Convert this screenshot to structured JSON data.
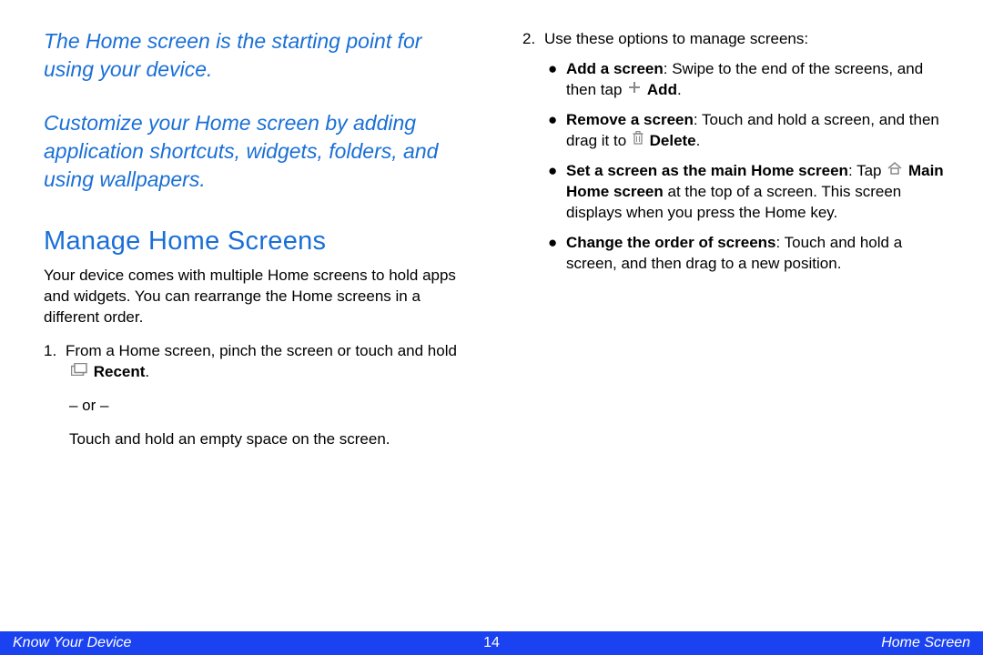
{
  "intro1": "The Home screen is the starting point for using your device.",
  "intro2": "Customize your Home screen by adding application shortcuts, widgets, folders, and using wallpapers.",
  "heading": "Manage Home Screens",
  "body1": "Your device comes with multiple Home screens to hold apps and widgets. You can rearrange the Home screens in a different order.",
  "step1": {
    "num": "1.",
    "line1a": "From a Home screen, pinch the screen or touch and hold ",
    "recent": "Recent",
    "line1b": ".",
    "or": "– or –",
    "line2": "Touch and hold an empty space on the screen."
  },
  "step2": {
    "num": "2.",
    "intro": "Use these options to manage screens:"
  },
  "bullets": {
    "add": {
      "label": "Add a screen",
      "t1": ": Swipe to the end of the screens, and then tap ",
      "action": "Add",
      "t2": "."
    },
    "remove": {
      "label": "Remove a screen",
      "t1": ": Touch and hold a screen, and then drag it to ",
      "action": "Delete",
      "t2": "."
    },
    "main": {
      "label": "Set a screen as the main Home screen",
      "t1": ": Tap ",
      "action": "Main Home screen",
      "t2": " at the top of a screen. This screen displays when you press the Home key."
    },
    "order": {
      "label": "Change the order of screens",
      "t1": ": Touch and hold a screen, and then drag to a new position."
    }
  },
  "footer": {
    "left": "Know Your Device",
    "center": "14",
    "right": "Home Screen"
  }
}
